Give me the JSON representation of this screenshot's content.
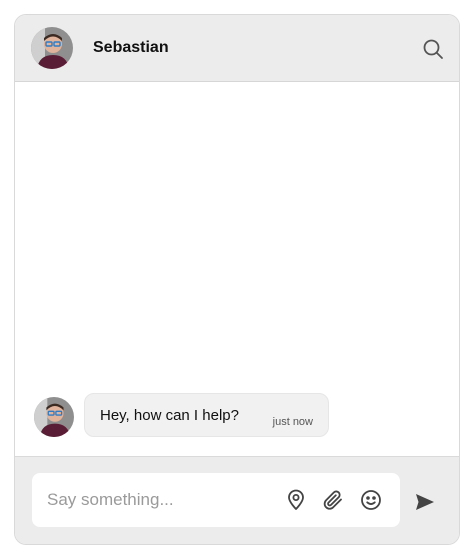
{
  "header": {
    "contact_name": "Sebastian",
    "search_icon": "search-icon"
  },
  "messages": [
    {
      "text": "Hey, how can I help?",
      "time": "just now"
    }
  ],
  "composer": {
    "placeholder": "Say something...",
    "icons": [
      "location-pin-icon",
      "paperclip-icon",
      "smiley-icon",
      "send-icon"
    ]
  },
  "colors": {
    "header_bg": "#ececec",
    "bubble_bg": "#f1f1f1",
    "footer_bg": "#ececec",
    "icon": "#444444"
  }
}
